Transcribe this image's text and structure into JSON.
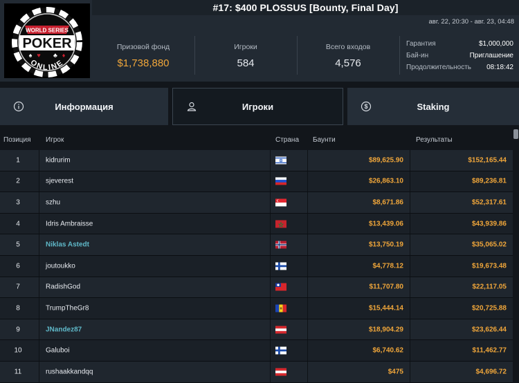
{
  "tournament": {
    "title": "#17: $400 PLOSSUS [Bounty, Final Day]",
    "dates": "авг. 22, 20:30 - авг. 23, 04:48",
    "logo_text": [
      "WORLD SERIES",
      "POKER",
      "ONLINE"
    ]
  },
  "stats": [
    {
      "label": "Призовой фонд",
      "value": "$1,738,880"
    },
    {
      "label": "Игроки",
      "value": "584"
    },
    {
      "label": "Всего входов",
      "value": "4,576"
    }
  ],
  "details": [
    {
      "label": "Гарантия",
      "value": "$1,000,000"
    },
    {
      "label": "Бай-ин",
      "value": "Приглашение"
    },
    {
      "label": "Продолжительность",
      "value": "08:18:42"
    }
  ],
  "tabs": [
    {
      "label": "Информация",
      "icon": "info-icon",
      "active": false
    },
    {
      "label": "Игроки",
      "icon": "user-icon",
      "active": true
    },
    {
      "label": "Staking",
      "icon": "dollar-icon",
      "active": false
    }
  ],
  "table": {
    "headers": {
      "position": "Позиция",
      "player": "Игрок",
      "country": "Страна",
      "bounty": "Баунти",
      "results": "Результаты"
    },
    "rows": [
      {
        "pos": "1",
        "name": "kidrurim",
        "flag": "israel",
        "bounty": "$89,625.90",
        "result": "$152,165.44",
        "highlight": false
      },
      {
        "pos": "2",
        "name": "sjeverest",
        "flag": "russia",
        "bounty": "$26,863.10",
        "result": "$89,236.81",
        "highlight": false
      },
      {
        "pos": "3",
        "name": "szhu",
        "flag": "singapore",
        "bounty": "$8,671.86",
        "result": "$52,317.61",
        "highlight": false
      },
      {
        "pos": "4",
        "name": "Idris Ambraisse",
        "flag": "morocco",
        "bounty": "$13,439.06",
        "result": "$43,939.86",
        "highlight": false
      },
      {
        "pos": "5",
        "name": "Niklas Astedt",
        "flag": "norway",
        "bounty": "$13,750.19",
        "result": "$35,065.02",
        "highlight": true
      },
      {
        "pos": "6",
        "name": "joutoukko",
        "flag": "finland",
        "bounty": "$4,778.12",
        "result": "$19,673.48",
        "highlight": false
      },
      {
        "pos": "7",
        "name": "RadishGod",
        "flag": "taiwan",
        "bounty": "$11,707.80",
        "result": "$22,117.05",
        "highlight": false
      },
      {
        "pos": "8",
        "name": "TrumpTheGr8",
        "flag": "moldova",
        "bounty": "$15,444.14",
        "result": "$20,725.88",
        "highlight": false
      },
      {
        "pos": "9",
        "name": "JNandez87",
        "flag": "austria",
        "bounty": "$18,904.29",
        "result": "$23,626.44",
        "highlight": true
      },
      {
        "pos": "10",
        "name": "Galuboi",
        "flag": "finland",
        "bounty": "$6,740.62",
        "result": "$11,462.77",
        "highlight": false
      },
      {
        "pos": "11",
        "name": "rushaakkandqq",
        "flag": "austria",
        "bounty": "$475",
        "result": "$4,696.72",
        "highlight": false
      }
    ]
  },
  "colors": {
    "accent": "#f0a63a",
    "highlight_name": "#5fb8c8",
    "background": "#12161b",
    "header": "#222a33"
  }
}
